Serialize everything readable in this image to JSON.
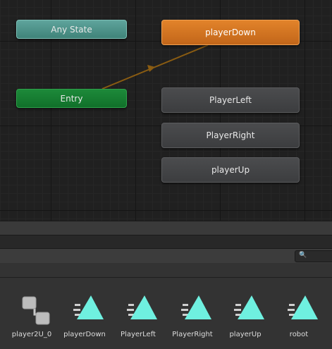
{
  "animator": {
    "states": {
      "any_state": "Any State",
      "entry": "Entry",
      "player_down": "playerDown",
      "player_left": "PlayerLeft",
      "player_right": "PlayerRight",
      "player_up": "playerUp"
    },
    "colors": {
      "any_state": "#4f958c",
      "entry": "#17803a",
      "default_state": "#d7761f",
      "state": "#444547",
      "transition": "#8a5c12",
      "grid": "#202020"
    }
  },
  "project": {
    "search_icon": "🔍",
    "assets": [
      {
        "label": "player2U_0",
        "icon": "animator-controller-icon"
      },
      {
        "label": "playerDown",
        "icon": "animation-clip-icon"
      },
      {
        "label": "PlayerLeft",
        "icon": "animation-clip-icon"
      },
      {
        "label": "PlayerRight",
        "icon": "animation-clip-icon"
      },
      {
        "label": "playerUp",
        "icon": "animation-clip-icon"
      },
      {
        "label": "robot",
        "icon": "animation-clip-icon"
      }
    ]
  }
}
